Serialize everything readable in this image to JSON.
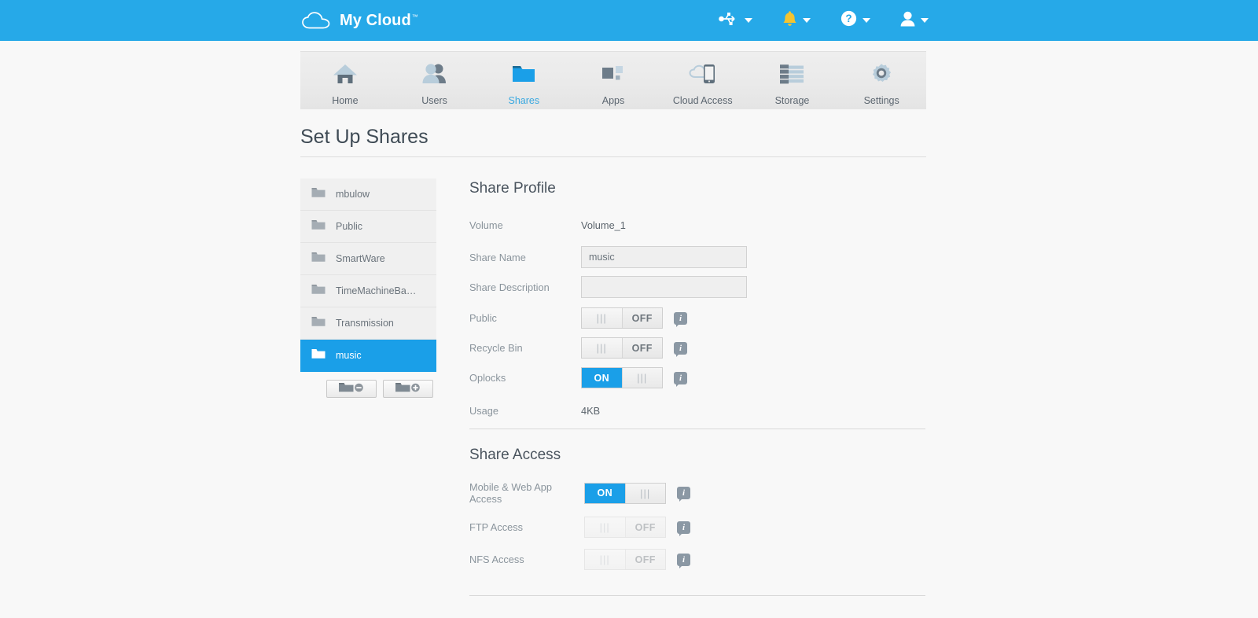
{
  "topbar": {
    "brand": "My Cloud",
    "trademark": "™",
    "logo_icon": "cloud-icon",
    "actions": [
      {
        "name": "usb-icon",
        "label": "USB",
        "icon": "usb-icon"
      },
      {
        "name": "alerts-icon",
        "label": "Alerts",
        "icon": "bell-icon",
        "color": "#f4c430"
      },
      {
        "name": "help-icon",
        "label": "Help",
        "icon": "question-circle-icon"
      },
      {
        "name": "user-icon",
        "label": "User",
        "icon": "person-icon"
      }
    ]
  },
  "nav": {
    "items": [
      {
        "label": "Home",
        "icon": "home-icon",
        "active": false
      },
      {
        "label": "Users",
        "icon": "users-icon",
        "active": false
      },
      {
        "label": "Shares",
        "icon": "folder-icon",
        "active": true
      },
      {
        "label": "Apps",
        "icon": "apps-icon",
        "active": false
      },
      {
        "label": "Cloud Access",
        "icon": "cloud-phone-icon",
        "active": false
      },
      {
        "label": "Storage",
        "icon": "storage-icon",
        "active": false
      },
      {
        "label": "Settings",
        "icon": "gear-icon",
        "active": false
      }
    ]
  },
  "page": {
    "title": "Set Up Shares"
  },
  "shares_list": {
    "items": [
      {
        "label": "mbulow",
        "selected": false
      },
      {
        "label": "Public",
        "selected": false
      },
      {
        "label": "SmartWare",
        "selected": false
      },
      {
        "label": "TimeMachineBa…",
        "selected": false
      },
      {
        "label": "Transmission",
        "selected": false
      },
      {
        "label": "music",
        "selected": true
      }
    ],
    "buttons": [
      {
        "name": "remove-share-button",
        "icon": "folder-minus-icon"
      },
      {
        "name": "add-share-button",
        "icon": "folder-plus-icon"
      }
    ]
  },
  "share_profile": {
    "heading": "Share Profile",
    "volume_label": "Volume",
    "volume_value": "Volume_1",
    "share_name_label": "Share Name",
    "share_name_value": "music",
    "share_name_placeholder": "",
    "share_description_label": "Share Description",
    "share_description_value": "",
    "share_description_placeholder": "",
    "public_label": "Public",
    "public_state": "OFF",
    "recycle_bin_label": "Recycle Bin",
    "recycle_bin_state": "OFF",
    "oplocks_label": "Oplocks",
    "oplocks_state": "ON",
    "usage_label": "Usage",
    "usage_value": "4KB",
    "grip": "|||"
  },
  "share_access": {
    "heading": "Share Access",
    "mobile_label": "Mobile & Web App Access",
    "mobile_state": "ON",
    "ftp_label": "FTP Access",
    "ftp_state": "OFF",
    "nfs_label": "NFS Access",
    "nfs_state": "OFF",
    "grip": "|||"
  },
  "colors": {
    "brand_blue": "#26a9e8",
    "accent_blue": "#1a9fe8",
    "active_link": "#39a8e0",
    "alert_yellow": "#f4c430",
    "page_bg": "#f8f8f8",
    "nav_bg": "#eaeaea",
    "info_gray": "#8b98a4"
  }
}
